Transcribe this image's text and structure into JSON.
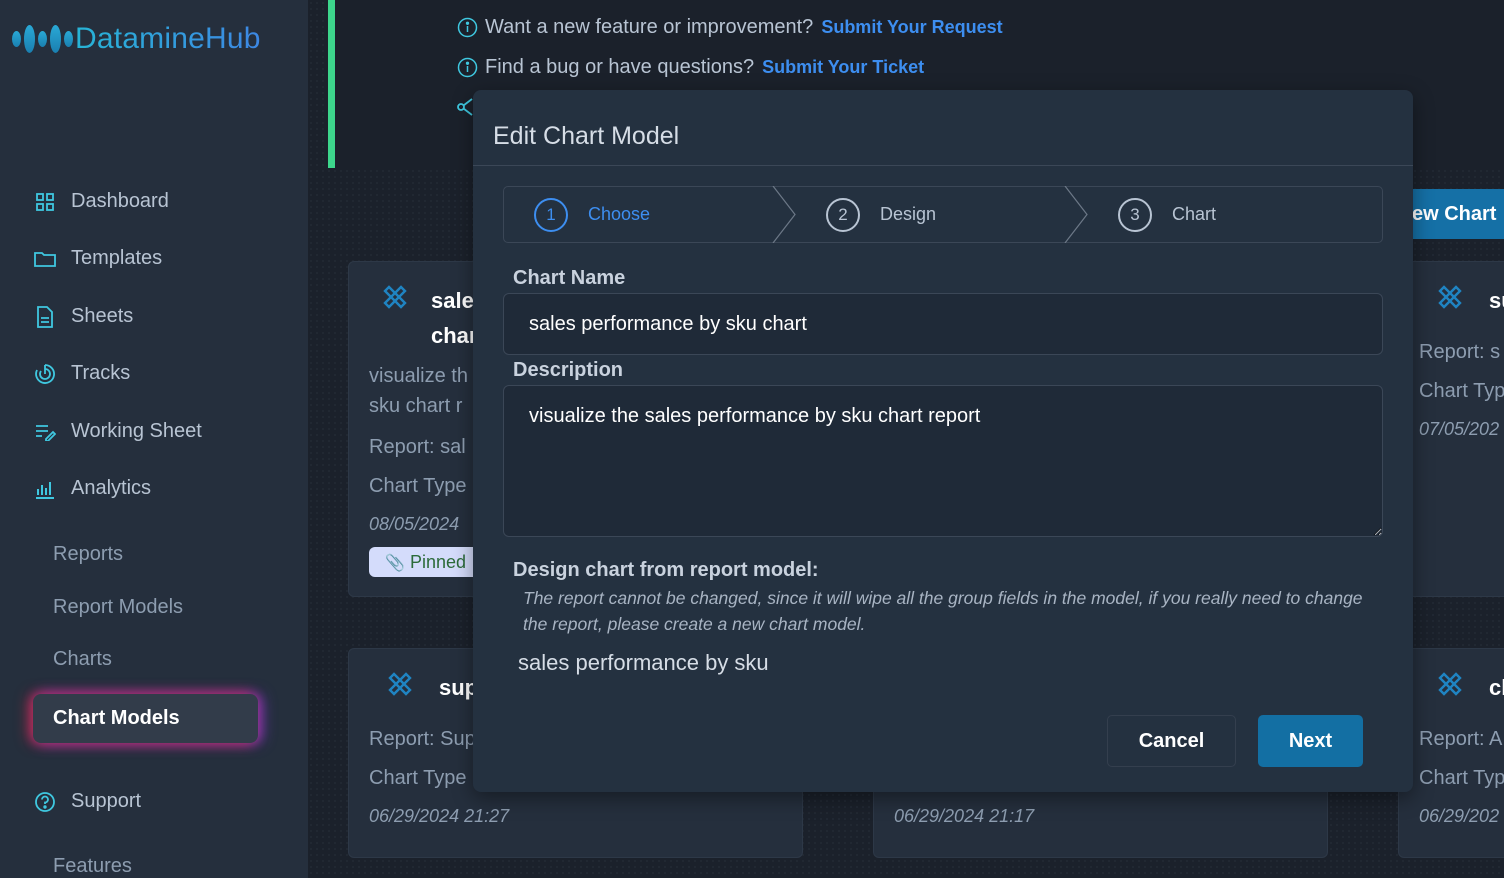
{
  "app": {
    "brand": "DatamineHub",
    "colors": {
      "accent": "#3d8ef0",
      "brand_cyan": "#27b4d6",
      "success_bar": "#3dd68c",
      "primary_button": "#136fa3",
      "active_glow_left": "#dc283c",
      "active_glow_right": "#823cdc"
    }
  },
  "sidebar": {
    "items": [
      {
        "label": "Dashboard",
        "icon": "grid-icon"
      },
      {
        "label": "Templates",
        "icon": "folder-icon"
      },
      {
        "label": "Sheets",
        "icon": "document-icon"
      },
      {
        "label": "Tracks",
        "icon": "target-icon"
      },
      {
        "label": "Working Sheet",
        "icon": "list-edit-icon"
      },
      {
        "label": "Analytics",
        "icon": "bar-chart-icon"
      }
    ],
    "analytics_sub": [
      {
        "label": "Reports"
      },
      {
        "label": "Report Models"
      },
      {
        "label": "Charts"
      },
      {
        "label": "Chart Models",
        "active": true
      }
    ],
    "support": {
      "label": "Support",
      "icon": "question-circle-icon"
    },
    "support_sub": [
      {
        "label": "Features"
      }
    ]
  },
  "banner": {
    "feature_text": "Want a new feature or improvement?",
    "feature_link": "Submit Your Request",
    "bug_text": "Find a bug or have questions?",
    "bug_link": "Submit Your Ticket"
  },
  "page": {
    "new_chart_button": "ew Chart"
  },
  "cards": [
    {
      "title_line1": "sale",
      "title_line2": "char",
      "desc_line1": "visualize th",
      "desc_line2": "sku chart r",
      "report": "Report: sal",
      "chart_type": "Chart Type",
      "date": "08/05/2024",
      "badge": "Pinned"
    },
    {
      "title": "su",
      "report": "Report: s",
      "chart_type": "Chart Typ",
      "date": "07/05/202"
    },
    {
      "title": "sup",
      "report": "Report: Sup",
      "chart_type": "Chart Type",
      "date": "06/29/2024 21:27"
    },
    {
      "date": "06/29/2024 21:17"
    },
    {
      "title": "cl",
      "report": "Report: A",
      "chart_type": "Chart Typ",
      "date": "06/29/202"
    }
  ],
  "modal": {
    "title": "Edit Chart Model",
    "steps": [
      {
        "number": "1",
        "label": "Choose",
        "active": true
      },
      {
        "number": "2",
        "label": "Design",
        "active": false
      },
      {
        "number": "3",
        "label": "Chart",
        "active": false
      }
    ],
    "chart_name_label": "Chart Name",
    "chart_name_value": "sales performance by sku chart",
    "description_label": "Description",
    "description_value": "visualize the sales performance by sku chart report",
    "design_label": "Design chart from report model:",
    "design_hint": "The report cannot be changed, since it will wipe all the group fields in the model, if you really need to change the report, please create a new chart model.",
    "report_model_name": "sales performance by sku",
    "cancel_label": "Cancel",
    "next_label": "Next"
  }
}
